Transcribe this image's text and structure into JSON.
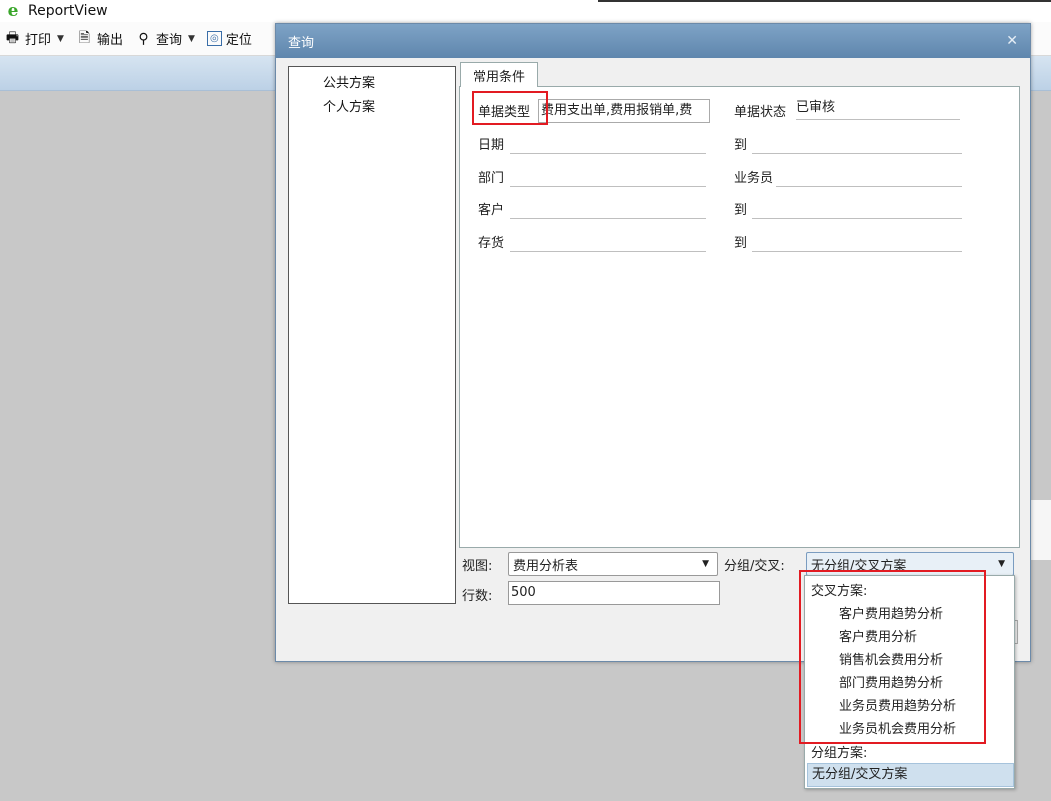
{
  "app": {
    "title": "ReportView"
  },
  "toolbar": {
    "print": "打印",
    "export": "输出",
    "query": "查询",
    "locate": "定位"
  },
  "dialog": {
    "title": "查询",
    "schemes": [
      "公共方案",
      "个人方案"
    ],
    "tab": "常用条件",
    "fields": {
      "doctype_label": "单据类型",
      "doctype_value": "费用支出单,费用报销单,费",
      "docstatus_label": "单据状态",
      "docstatus_value": "已审核",
      "date_label": "日期",
      "to": "到",
      "dept_label": "部门",
      "salesman_label": "业务员",
      "customer_label": "客户",
      "inventory_label": "存货"
    },
    "view_label": "视图:",
    "view_value": "费用分析表",
    "group_label": "分组/交叉:",
    "group_value": "无分组/交叉方案",
    "rows_label": "行数:",
    "rows_value": "500"
  },
  "dropdown": {
    "cross_header": "交叉方案:",
    "cross_items": [
      "客户费用趋势分析",
      "客户费用分析",
      "销售机会费用分析",
      "部门费用趋势分析",
      "业务员费用趋势分析",
      "业务员机会费用分析"
    ],
    "group_header": "分组方案:",
    "selected": "无分组/交叉方案"
  },
  "colors": {
    "highlight_box": "#e21b22",
    "title_bar": "#5f86ad",
    "selection": "#cfe0ee"
  }
}
